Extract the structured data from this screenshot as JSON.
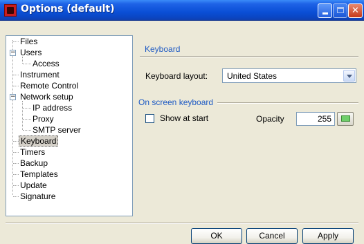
{
  "window": {
    "title": "Options (default)"
  },
  "tree": {
    "items": [
      {
        "label": "Files"
      },
      {
        "label": "Users"
      },
      {
        "label": "Access"
      },
      {
        "label": "Instrument"
      },
      {
        "label": "Remote Control"
      },
      {
        "label": "Network setup"
      },
      {
        "label": "IP address"
      },
      {
        "label": "Proxy"
      },
      {
        "label": "SMTP server"
      },
      {
        "label": "Keyboard"
      },
      {
        "label": "Timers"
      },
      {
        "label": "Backup"
      },
      {
        "label": "Templates"
      },
      {
        "label": "Update"
      },
      {
        "label": "Signature"
      }
    ],
    "selected": "Keyboard"
  },
  "panel": {
    "heading": "Keyboard",
    "layout_label": "Keyboard layout:",
    "layout_value": "United States",
    "osk_heading": "On screen keyboard",
    "show_at_start_label": "Show at start",
    "show_at_start_checked": false,
    "opacity_label": "Opacity",
    "opacity_value": "255"
  },
  "buttons": {
    "ok": "OK",
    "cancel": "Cancel",
    "apply": "Apply"
  },
  "colors": {
    "title_bar": "#0A4FD6",
    "accent": "#1F5BC4",
    "dialog_bg": "#ECE9D8",
    "opacity_swatch": "#6FCF6A"
  }
}
